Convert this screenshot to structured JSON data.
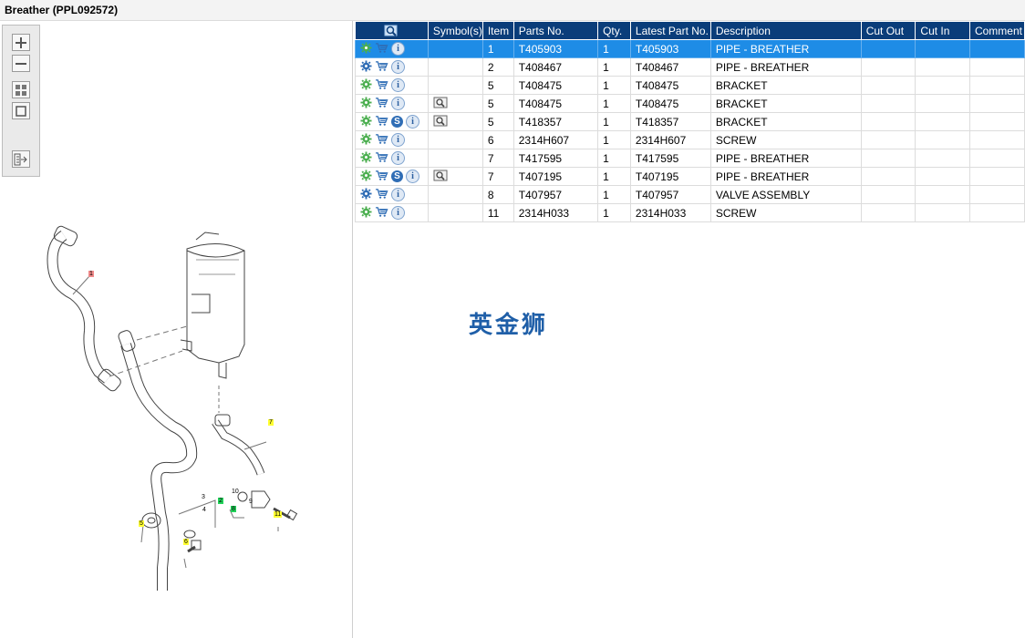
{
  "window": {
    "title": "Breather (PPL092572)"
  },
  "toolbar": {
    "icons": [
      "zoom-in-icon",
      "zoom-out-icon",
      "fit-page-icon",
      "actual-size-icon",
      "export-icon"
    ]
  },
  "table": {
    "headers": {
      "symbols": "Symbol(s)",
      "item": "Item",
      "parts_no": "Parts No.",
      "qty": "Qty.",
      "latest": "Latest Part No.",
      "description": "Description",
      "cut_out": "Cut Out",
      "cut_in": "Cut In",
      "comment": "Comment"
    },
    "rows": [
      {
        "icon_gear": "gear-green",
        "has_s": false,
        "has_sym": false,
        "item": "1",
        "parts_no": "T405903",
        "qty": "1",
        "latest": "T405903",
        "description": "PIPE - BREATHER",
        "selected": true
      },
      {
        "icon_gear": "gear-blue",
        "has_s": false,
        "has_sym": false,
        "item": "2",
        "parts_no": "T408467",
        "qty": "1",
        "latest": "T408467",
        "description": "PIPE - BREATHER",
        "selected": false
      },
      {
        "icon_gear": "gear-green",
        "has_s": false,
        "has_sym": false,
        "item": "5",
        "parts_no": "T408475",
        "qty": "1",
        "latest": "T408475",
        "description": "BRACKET",
        "selected": false
      },
      {
        "icon_gear": "gear-green",
        "has_s": false,
        "has_sym": true,
        "item": "5",
        "parts_no": "T408475",
        "qty": "1",
        "latest": "T408475",
        "description": "BRACKET",
        "selected": false
      },
      {
        "icon_gear": "gear-green",
        "has_s": true,
        "has_sym": true,
        "item": "5",
        "parts_no": "T418357",
        "qty": "1",
        "latest": "T418357",
        "description": "BRACKET",
        "selected": false
      },
      {
        "icon_gear": "gear-green",
        "has_s": false,
        "has_sym": false,
        "item": "6",
        "parts_no": "2314H607",
        "qty": "1",
        "latest": "2314H607",
        "description": "SCREW",
        "selected": false
      },
      {
        "icon_gear": "gear-green",
        "has_s": false,
        "has_sym": false,
        "item": "7",
        "parts_no": "T417595",
        "qty": "1",
        "latest": "T417595",
        "description": "PIPE - BREATHER",
        "selected": false
      },
      {
        "icon_gear": "gear-green",
        "has_s": true,
        "has_sym": true,
        "item": "7",
        "parts_no": "T407195",
        "qty": "1",
        "latest": "T407195",
        "description": "PIPE - BREATHER",
        "selected": false
      },
      {
        "icon_gear": "gear-blue",
        "has_s": false,
        "has_sym": false,
        "item": "8",
        "parts_no": "T407957",
        "qty": "1",
        "latest": "T407957",
        "description": "VALVE ASSEMBLY",
        "selected": false
      },
      {
        "icon_gear": "gear-green",
        "has_s": false,
        "has_sym": false,
        "item": "11",
        "parts_no": "2314H033",
        "qty": "1",
        "latest": "2314H033",
        "description": "SCREW",
        "selected": false
      }
    ]
  },
  "watermark": "英金狮",
  "diagram": {
    "callouts": [
      {
        "label": "1",
        "color": "#f08a8a"
      },
      {
        "label": "2",
        "color": "#22d35a"
      },
      {
        "label": "3",
        "color": "none"
      },
      {
        "label": "4",
        "color": "none"
      },
      {
        "label": "5",
        "color": "#ffff33"
      },
      {
        "label": "6",
        "color": "#ffff33"
      },
      {
        "label": "7",
        "color": "#ffff33"
      },
      {
        "label": "8",
        "color": "#22d35a"
      },
      {
        "label": "9",
        "color": "none"
      },
      {
        "label": "10",
        "color": "none"
      },
      {
        "label": "11",
        "color": "#ffff33"
      }
    ]
  },
  "colors": {
    "header_bg": "#0a3d7a",
    "selected_row": "#1e8ce6",
    "gear_green": "#4caf50",
    "gear_blue": "#2f6db5"
  }
}
